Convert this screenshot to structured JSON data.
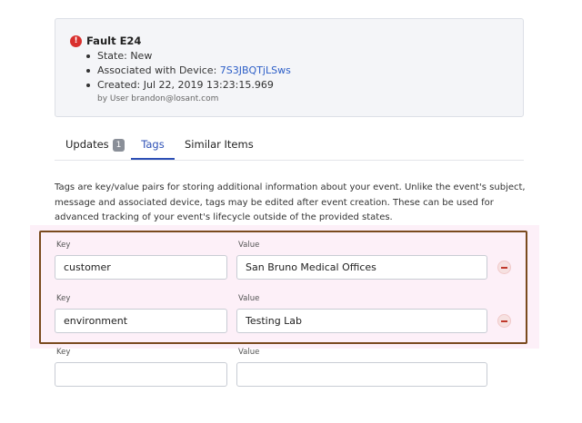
{
  "event": {
    "title": "Fault E24",
    "alert_icon_glyph": "!",
    "state_text": "State: New",
    "device_prefix": "Associated with Device: ",
    "device_id": "7S3JBQTjLSws",
    "created_text": "Created: Jul 22, 2019 13:23:15.969",
    "created_by": "by User brandon@losant.com"
  },
  "tabs": {
    "updates_label": "Updates",
    "updates_count": "1",
    "tags_label": "Tags",
    "similar_label": "Similar Items",
    "active": "tags",
    "accent_color": "#2c4fb5"
  },
  "description": "Tags are key/value pairs for storing additional information about your event. Unlike the event's subject, message and associated device, tags may be edited after event creation. These can be used for advanced tracking of your event's lifecycle outside of the provided states.",
  "tag_rows": [
    {
      "key_label": "Key",
      "value_label": "Value",
      "key": "customer",
      "value": "San Bruno Medical Offices"
    },
    {
      "key_label": "Key",
      "value_label": "Value",
      "key": "environment",
      "value": "Testing Lab"
    },
    {
      "key_label": "Key",
      "value_label": "Value",
      "key": "",
      "value": ""
    }
  ],
  "icons": {
    "alert": "alert-circle-icon",
    "remove": "minus-circle-icon"
  },
  "colors": {
    "alert": "#d9302e",
    "link": "#2c5ec7",
    "highlight_border": "#7a4a1e",
    "remove": "#c0392b"
  }
}
